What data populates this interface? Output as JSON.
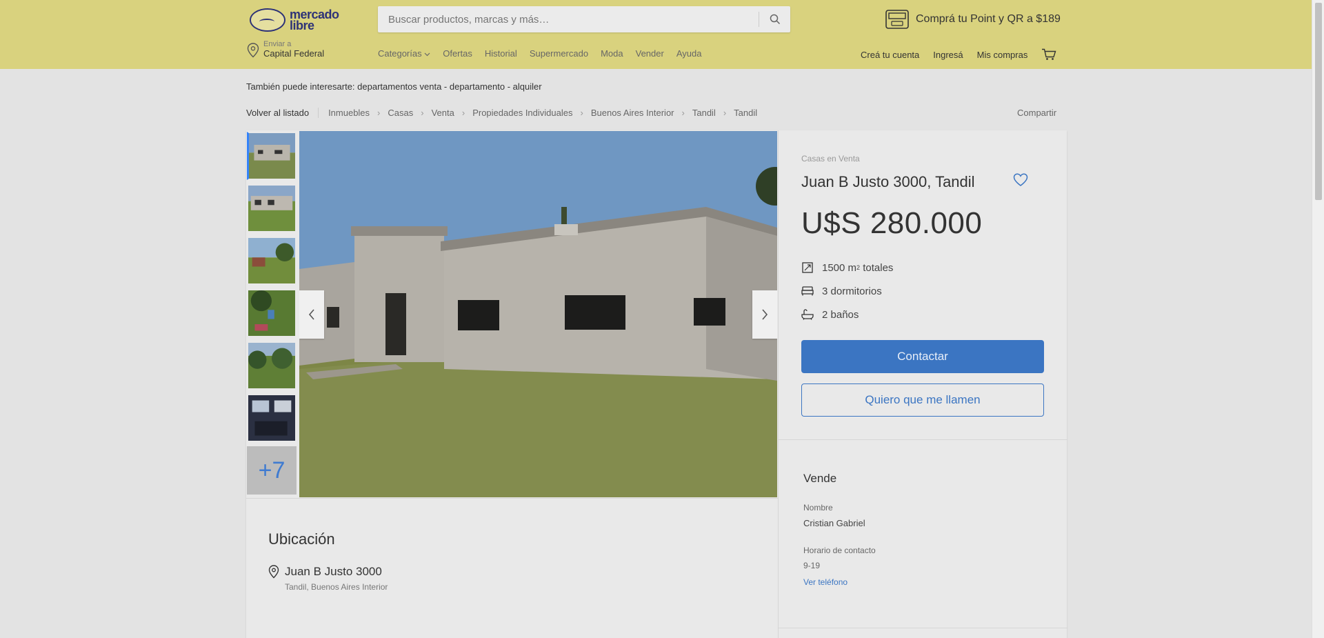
{
  "header": {
    "logo_text_1": "mercado",
    "logo_text_2": "libre",
    "search_placeholder": "Buscar productos, marcas y más…",
    "promo": "Comprá tu Point y QR a $189",
    "ship_label": "Enviar a",
    "ship_city": "Capital Federal",
    "nav": [
      "Categorías",
      "Ofertas",
      "Historial",
      "Supermercado",
      "Moda",
      "Vender",
      "Ayuda"
    ],
    "user_nav": [
      "Creá tu cuenta",
      "Ingresá",
      "Mis compras"
    ]
  },
  "interest": {
    "label": "También puede interesarte:",
    "links": "departamentos venta - departamento - alquiler"
  },
  "breadcrumb": {
    "back": "Volver al listado",
    "items": [
      "Inmuebles",
      "Casas",
      "Venta",
      "Propiedades Individuales",
      "Buenos Aires Interior",
      "Tandil",
      "Tandil"
    ],
    "share": "Compartir"
  },
  "gallery": {
    "more_count": "+7"
  },
  "product": {
    "condition": "Casas en Venta",
    "title": "Juan B Justo 3000, Tandil",
    "price": "U$S 280.000",
    "area_value": "1500 m",
    "area_sup": "2",
    "area_suffix": " totales",
    "bedrooms": "3 dormitorios",
    "bathrooms": "2 baños",
    "contact_button": "Contactar",
    "call_button": "Quiero que me llamen"
  },
  "seller": {
    "heading": "Vende",
    "name_label": "Nombre",
    "name": "Cristian Gabriel",
    "hours_label": "Horario de contacto",
    "hours": "9-19",
    "phone_link": "Ver teléfono"
  },
  "location": {
    "heading": "Ubicación",
    "address": "Juan B Justo 3000",
    "region": "Tandil, Buenos Aires Interior"
  },
  "colors": {
    "header_bg": "#d9d27e",
    "accent": "#3b75c2",
    "page_bg": "#e3e3e3"
  }
}
